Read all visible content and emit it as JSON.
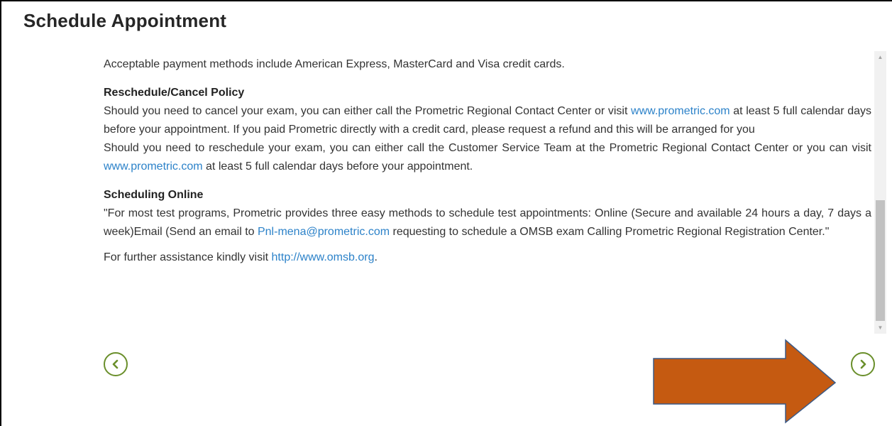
{
  "header": {
    "title": "Schedule Appointment"
  },
  "content": {
    "payment_text": "Acceptable payment methods include American Express, MasterCard and Visa credit cards.",
    "reschedule": {
      "heading": "Reschedule/Cancel Policy",
      "p1_before": "Should you need to cancel your exam, you can either call the Prometric Regional Contact Center or visit ",
      "p1_link": "www.prometric.com",
      "p1_after": " at least 5 full calendar days before your appointment. If you paid Prometric directly with a credit card, please request a refund and this will be arranged for you",
      "p2_before": "Should you need to reschedule your exam, you can either call the Customer Service Team at the Prometric Regional Contact Center or you can visit ",
      "p2_link": "www.prometric.com",
      "p2_after": " at least 5 full calendar days before your appointment."
    },
    "scheduling": {
      "heading": "Scheduling Online",
      "text_before": "\"For most test programs, Prometric provides three easy methods to schedule test appointments: Online (Secure and available 24 hours a day, 7 days a week)Email (Send an email to ",
      "email": "Pnl-mena@prometric.com",
      "text_after": " requesting to schedule a OMSB exam Calling Prometric Regional Registration Center.\""
    },
    "assistance": {
      "before": "For further assistance kindly visit ",
      "link": "http://www.omsb.org",
      "after": "."
    }
  },
  "navigation": {
    "prev_icon": "chevron-left-icon",
    "next_icon": "chevron-right-icon",
    "accent_color": "#6a8f2b"
  },
  "annotation": {
    "arrow_color": "#c55a11",
    "arrow_icon": "arrow-right-icon"
  }
}
